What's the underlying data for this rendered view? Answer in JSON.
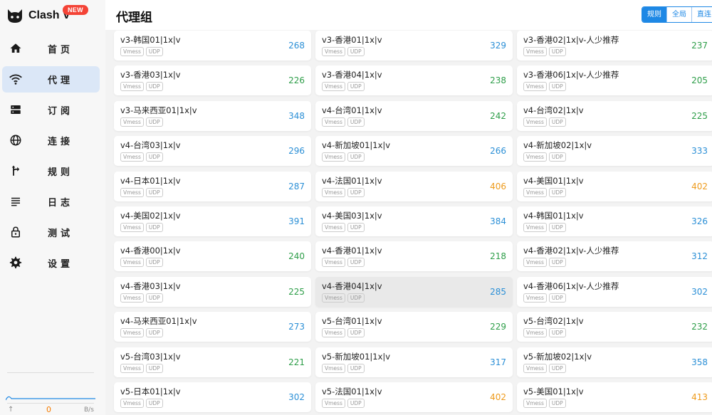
{
  "app": {
    "name": "Clash V",
    "badge": "NEW"
  },
  "header": {
    "title": "代理组",
    "modes": [
      {
        "label": "规则",
        "active": true
      },
      {
        "label": "全局",
        "active": false
      },
      {
        "label": "直连",
        "active": false
      }
    ]
  },
  "sidebar": {
    "items": [
      {
        "label": "首页",
        "icon": "home-icon",
        "active": false
      },
      {
        "label": "代理",
        "icon": "wifi-icon",
        "active": true
      },
      {
        "label": "订阅",
        "icon": "dns-icon",
        "active": false
      },
      {
        "label": "连接",
        "icon": "globe-icon",
        "active": false
      },
      {
        "label": "规则",
        "icon": "route-icon",
        "active": false
      },
      {
        "label": "日志",
        "icon": "log-icon",
        "active": false
      },
      {
        "label": "测试",
        "icon": "lock-icon",
        "active": false
      },
      {
        "label": "设置",
        "icon": "gear-icon",
        "active": false
      }
    ],
    "traffic": {
      "up_arrow": "↑",
      "value": "0",
      "unit": "B/s"
    }
  },
  "colors": {
    "accent": "#1e88e5",
    "active_nav": "#dbe7f7",
    "delay_blue": "#2b8fd6",
    "delay_green": "#2e9e49",
    "delay_orange": "#ee9a1b"
  },
  "proxies": [
    {
      "name": "v3-韩国01|1x|v",
      "tags": [
        "Vmess",
        "UDP"
      ],
      "delay": "268",
      "level": "blue"
    },
    {
      "name": "v3-香港01|1x|v",
      "tags": [
        "Vmess",
        "UDP"
      ],
      "delay": "329",
      "level": "blue"
    },
    {
      "name": "v3-香港02|1x|v-人少推荐",
      "tags": [
        "Vmess",
        "UDP"
      ],
      "delay": "237",
      "level": "green"
    },
    {
      "name": "v3-香港03|1x|v",
      "tags": [
        "Vmess",
        "UDP"
      ],
      "delay": "226",
      "level": "green"
    },
    {
      "name": "v3-香港04|1x|v",
      "tags": [
        "Vmess",
        "UDP"
      ],
      "delay": "238",
      "level": "green"
    },
    {
      "name": "v3-香港06|1x|v-人少推荐",
      "tags": [
        "Vmess",
        "UDP"
      ],
      "delay": "205",
      "level": "green"
    },
    {
      "name": "v3-马来西亚01|1x|v",
      "tags": [
        "Vmess",
        "UDP"
      ],
      "delay": "348",
      "level": "blue"
    },
    {
      "name": "v4-台湾01|1x|v",
      "tags": [
        "Vmess",
        "UDP"
      ],
      "delay": "242",
      "level": "green"
    },
    {
      "name": "v4-台湾02|1x|v",
      "tags": [
        "Vmess",
        "UDP"
      ],
      "delay": "225",
      "level": "green"
    },
    {
      "name": "v4-台湾03|1x|v",
      "tags": [
        "Vmess",
        "UDP"
      ],
      "delay": "296",
      "level": "blue"
    },
    {
      "name": "v4-新加坡01|1x|v",
      "tags": [
        "Vmess",
        "UDP"
      ],
      "delay": "266",
      "level": "blue"
    },
    {
      "name": "v4-新加坡02|1x|v",
      "tags": [
        "Vmess",
        "UDP"
      ],
      "delay": "333",
      "level": "blue"
    },
    {
      "name": "v4-日本01|1x|v",
      "tags": [
        "Vmess",
        "UDP"
      ],
      "delay": "287",
      "level": "blue"
    },
    {
      "name": "v4-法国01|1x|v",
      "tags": [
        "Vmess",
        "UDP"
      ],
      "delay": "406",
      "level": "orange"
    },
    {
      "name": "v4-美国01|1x|v",
      "tags": [
        "Vmess",
        "UDP"
      ],
      "delay": "402",
      "level": "orange"
    },
    {
      "name": "v4-美国02|1x|v",
      "tags": [
        "Vmess",
        "UDP"
      ],
      "delay": "391",
      "level": "blue"
    },
    {
      "name": "v4-美国03|1x|v",
      "tags": [
        "Vmess",
        "UDP"
      ],
      "delay": "384",
      "level": "blue"
    },
    {
      "name": "v4-韩国01|1x|v",
      "tags": [
        "Vmess",
        "UDP"
      ],
      "delay": "326",
      "level": "blue"
    },
    {
      "name": "v4-香港00|1x|v",
      "tags": [
        "Vmess",
        "UDP"
      ],
      "delay": "240",
      "level": "green"
    },
    {
      "name": "v4-香港01|1x|v",
      "tags": [
        "Vmess",
        "UDP"
      ],
      "delay": "218",
      "level": "green"
    },
    {
      "name": "v4-香港02|1x|v-人少推荐",
      "tags": [
        "Vmess",
        "UDP"
      ],
      "delay": "312",
      "level": "blue"
    },
    {
      "name": "v4-香港03|1x|v",
      "tags": [
        "Vmess",
        "UDP"
      ],
      "delay": "225",
      "level": "green"
    },
    {
      "name": "v4-香港04|1x|v",
      "tags": [
        "Vmess",
        "UDP"
      ],
      "delay": "285",
      "level": "blue",
      "selected": true
    },
    {
      "name": "v4-香港06|1x|v-人少推荐",
      "tags": [
        "Vmess",
        "UDP"
      ],
      "delay": "302",
      "level": "blue"
    },
    {
      "name": "v4-马来西亚01|1x|v",
      "tags": [
        "Vmess",
        "UDP"
      ],
      "delay": "273",
      "level": "blue"
    },
    {
      "name": "v5-台湾01|1x|v",
      "tags": [
        "Vmess",
        "UDP"
      ],
      "delay": "229",
      "level": "green"
    },
    {
      "name": "v5-台湾02|1x|v",
      "tags": [
        "Vmess",
        "UDP"
      ],
      "delay": "232",
      "level": "green"
    },
    {
      "name": "v5-台湾03|1x|v",
      "tags": [
        "Vmess",
        "UDP"
      ],
      "delay": "221",
      "level": "green"
    },
    {
      "name": "v5-新加坡01|1x|v",
      "tags": [
        "Vmess",
        "UDP"
      ],
      "delay": "317",
      "level": "blue"
    },
    {
      "name": "v5-新加坡02|1x|v",
      "tags": [
        "Vmess",
        "UDP"
      ],
      "delay": "358",
      "level": "blue"
    },
    {
      "name": "v5-日本01|1x|v",
      "tags": [
        "Vmess",
        "UDP"
      ],
      "delay": "302",
      "level": "blue"
    },
    {
      "name": "v5-法国01|1x|v",
      "tags": [
        "Vmess",
        "UDP"
      ],
      "delay": "402",
      "level": "orange"
    },
    {
      "name": "v5-美国01|1x|v",
      "tags": [
        "Vmess",
        "UDP"
      ],
      "delay": "413",
      "level": "orange"
    }
  ]
}
